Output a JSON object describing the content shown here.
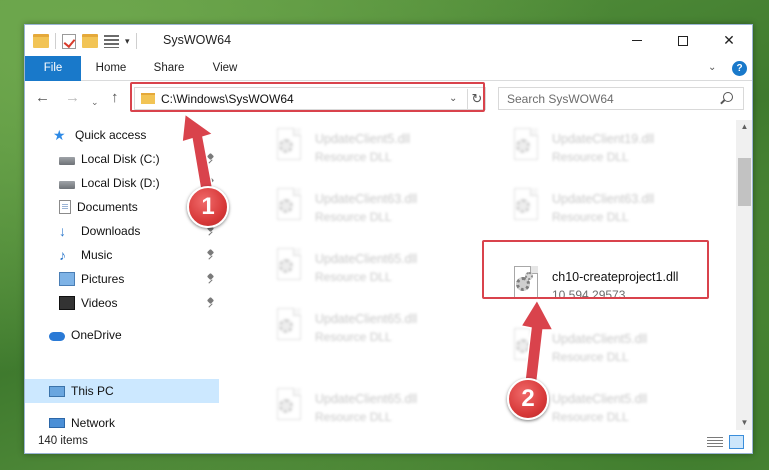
{
  "window": {
    "title": "SysWOW64"
  },
  "ribbon": {
    "tabs": [
      "File",
      "Home",
      "Share",
      "View"
    ],
    "help": "?"
  },
  "nav": {
    "back": "←",
    "forward": "→",
    "recent": "⌄",
    "up": "↑"
  },
  "address": {
    "path": "C:\\Windows\\SysWOW64",
    "dropdown": "⌄",
    "refresh": "↻"
  },
  "search": {
    "placeholder": "Search SysWOW64"
  },
  "sidebar": {
    "items": [
      {
        "label": "Quick access",
        "icon": "star-icon",
        "pinned": false
      },
      {
        "label": "Local Disk (C:)",
        "icon": "disk-icon",
        "pinned": true
      },
      {
        "label": "Local Disk (D:)",
        "icon": "disk-icon",
        "pinned": true
      },
      {
        "label": "Documents",
        "icon": "documents-icon",
        "pinned": true
      },
      {
        "label": "Downloads",
        "icon": "download-icon",
        "pinned": true
      },
      {
        "label": "Music",
        "icon": "music-icon",
        "pinned": true
      },
      {
        "label": "Pictures",
        "icon": "pictures-icon",
        "pinned": true
      },
      {
        "label": "Videos",
        "icon": "videos-icon",
        "pinned": true
      },
      {
        "label": "OneDrive",
        "icon": "onedrive-icon",
        "pinned": false
      },
      {
        "label": "This PC",
        "icon": "pc-icon",
        "pinned": false,
        "selected": true
      },
      {
        "label": "Network",
        "icon": "network-icon",
        "pinned": false
      }
    ]
  },
  "files": [
    {
      "name": "UpdateClient5.dll",
      "sub": "Resource DLL",
      "blurred": true
    },
    {
      "name": "UpdateClient19.dll",
      "sub": "Resource DLL",
      "blurred": true
    },
    {
      "name": "UpdateClient63.dll",
      "sub": "Resource DLL",
      "blurred": true
    },
    {
      "name": "UpdateClient63.dll",
      "sub": "Resource DLL",
      "blurred": true
    },
    {
      "name": "UpdateClient65.dll",
      "sub": "Resource DLL",
      "blurred": true
    },
    {
      "name": "ch10-createproject1.dll",
      "sub": "10.594.29573",
      "blurred": false
    },
    {
      "name": "UpdateClient65.dll",
      "sub": "Resource DLL",
      "blurred": true
    },
    {
      "name": "UpdateClient5.dll",
      "sub": "Resource DLL",
      "blurred": true
    },
    {
      "name": "UpdateClient65.dll",
      "sub": "Resource DLL",
      "blurred": true
    },
    {
      "name": "UpdateClient5.dll",
      "sub": "Resource DLL",
      "blurred": true
    }
  ],
  "status": {
    "item_count": "140 items"
  },
  "annotations": {
    "step1": "1",
    "step2": "2",
    "color": "#d9434c"
  },
  "colors": {
    "file_tab": "#1979ca",
    "selection": "#cce8ff"
  }
}
